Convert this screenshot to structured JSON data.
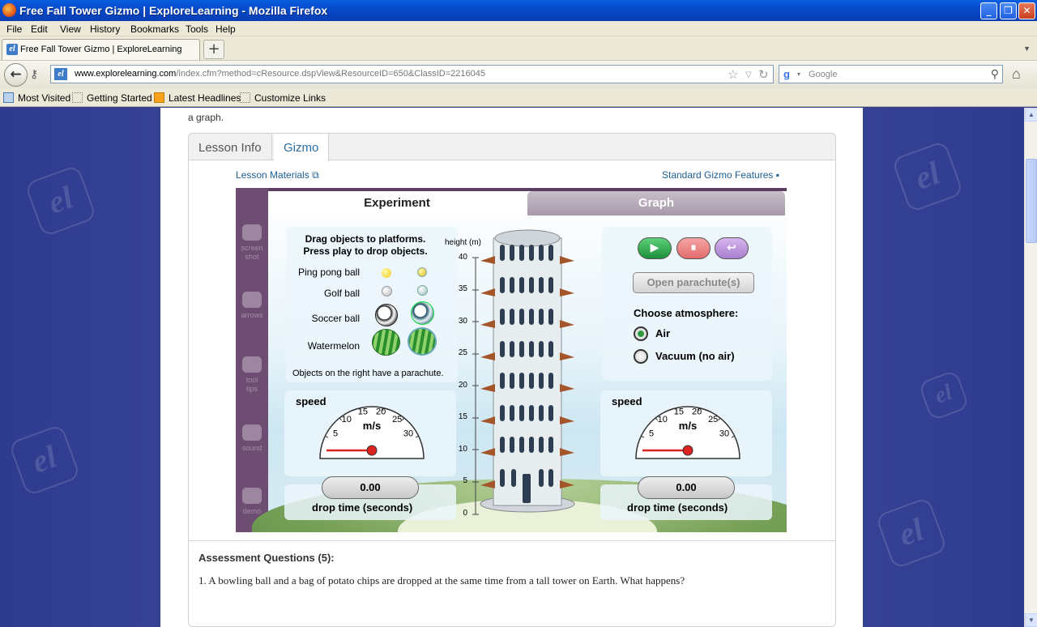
{
  "window": {
    "title": "Free Fall Tower Gizmo | ExploreLearning - Mozilla Firefox"
  },
  "menu": [
    "File",
    "Edit",
    "View",
    "History",
    "Bookmarks",
    "Tools",
    "Help"
  ],
  "tab": {
    "title": "Free Fall Tower Gizmo | ExploreLearning",
    "new_tab": "+"
  },
  "nav": {
    "url_domain": "www.explorelearning.com",
    "url_path": "/index.cfm?method=cResource.dspView&ResourceID=650&ClassID=2216045",
    "search_placeholder": "Google"
  },
  "bookmarks": [
    "Most Visited",
    "Getting Started",
    "Latest Headlines",
    "Customize Links"
  ],
  "page": {
    "intro_tail": "a graph.",
    "tabs": [
      "Lesson Info",
      "Gizmo"
    ],
    "lesson_materials": "Lesson Materials",
    "standard_features": "Standard Gizmo Features",
    "assessment_title": "Assessment Questions (5):",
    "question_1": "1.  A bowling ball and a bag of potato chips are dropped at the same time from a tall tower on Earth. What happens?"
  },
  "sim": {
    "sidebar": [
      {
        "line1": "screen",
        "line2": "shot"
      },
      {
        "line1": "arrows",
        "line2": ""
      },
      {
        "line1": "tool",
        "line2": "tips"
      },
      {
        "line1": "sound",
        "line2": ""
      },
      {
        "line1": "demo",
        "line2": ""
      }
    ],
    "tab_experiment": "Experiment",
    "tab_graph": "Graph",
    "instructions_1": "Drag objects to platforms.",
    "instructions_2": "Press play to drop objects.",
    "objects": [
      "Ping pong ball",
      "Golf ball",
      "Soccer ball",
      "Watermelon"
    ],
    "parachute_note": "Objects on the right have a parachute.",
    "height_label": "height (m)",
    "height_ticks": [
      "40",
      "35",
      "30",
      "25",
      "20",
      "15",
      "10",
      "5",
      "0"
    ],
    "buttons": {
      "play": "▶",
      "pause": "⏸",
      "reset": "↩"
    },
    "open_parachutes": "Open parachute(s)",
    "atmosphere_label": "Choose atmosphere:",
    "atmosphere_options": [
      "Air",
      "Vacuum (no air)"
    ],
    "atmosphere_selected": "Air",
    "speed_label": "speed",
    "speed_unit": "m/s",
    "gauge_ticks": [
      "5",
      "10",
      "15",
      "20",
      "25",
      "30"
    ],
    "left_speed": 0,
    "right_speed": 0,
    "left_drop_time": "0.00",
    "right_drop_time": "0.00",
    "drop_time_label": "drop time (seconds)"
  }
}
